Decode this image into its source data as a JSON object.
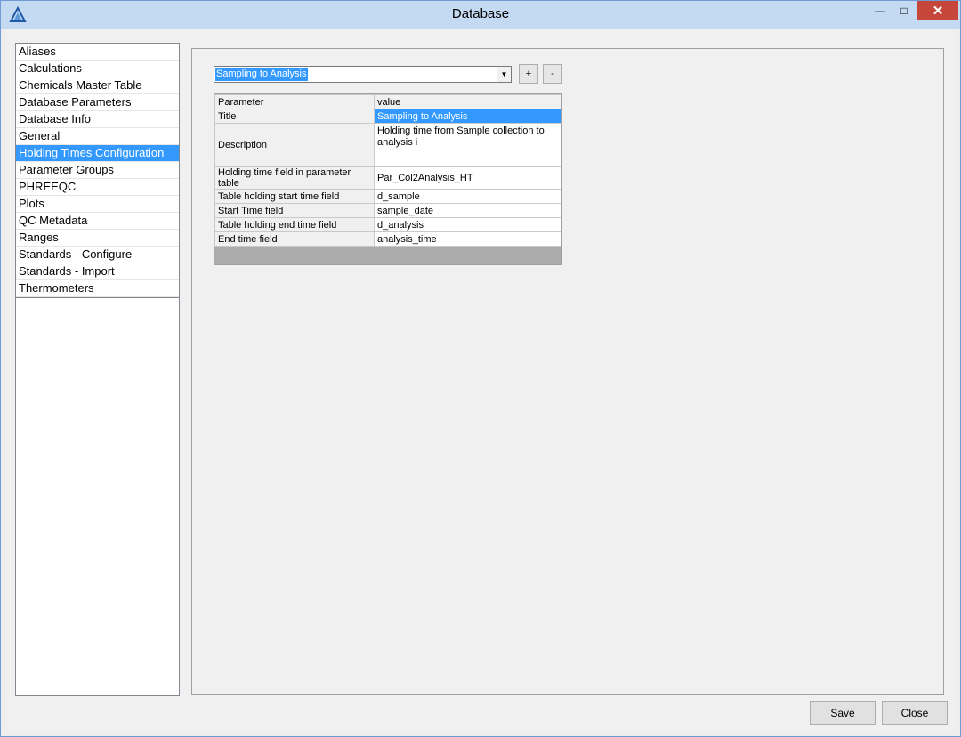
{
  "window": {
    "title": "Database",
    "controls": {
      "minimize": "—",
      "maximize": "□",
      "close": "✕"
    }
  },
  "nav": {
    "items": [
      {
        "label": "Aliases",
        "selected": false
      },
      {
        "label": "Calculations",
        "selected": false
      },
      {
        "label": "Chemicals Master Table",
        "selected": false
      },
      {
        "label": "Database Parameters",
        "selected": false
      },
      {
        "label": "Database Info",
        "selected": false
      },
      {
        "label": "General",
        "selected": false
      },
      {
        "label": "Holding Times Configuration",
        "selected": true
      },
      {
        "label": "Parameter Groups",
        "selected": false
      },
      {
        "label": "PHREEQC",
        "selected": false
      },
      {
        "label": "Plots",
        "selected": false
      },
      {
        "label": "QC Metadata",
        "selected": false
      },
      {
        "label": "Ranges",
        "selected": false
      },
      {
        "label": "Standards - Configure",
        "selected": false
      },
      {
        "label": "Standards - Import",
        "selected": false
      },
      {
        "label": "Thermometers",
        "selected": false
      }
    ]
  },
  "config": {
    "selected": "Sampling to Analysis",
    "add_label": "+",
    "remove_label": "-"
  },
  "grid": {
    "headers": [
      "Parameter",
      "value"
    ],
    "rows": [
      {
        "parameter": "Title",
        "value": "Sampling to Analysis"
      },
      {
        "parameter": "Description",
        "value": "Holding time from Sample collection to analysis i"
      },
      {
        "parameter": "Holding time field in parameter table",
        "value": "Par_Col2Analysis_HT"
      },
      {
        "parameter": "Table holding start time field",
        "value": "d_sample"
      },
      {
        "parameter": "Start Time field",
        "value": "sample_date"
      },
      {
        "parameter": "Table holding end time field",
        "value": "d_analysis"
      },
      {
        "parameter": "End time field",
        "value": "analysis_time"
      }
    ]
  },
  "footer": {
    "save_label": "Save",
    "close_label": "Close"
  }
}
